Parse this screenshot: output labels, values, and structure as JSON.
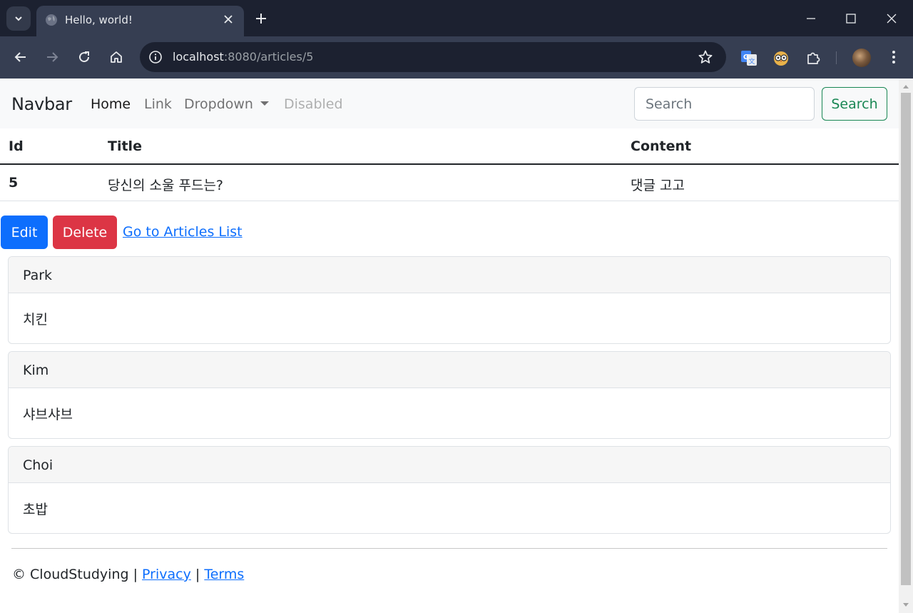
{
  "browser": {
    "tab_title": "Hello, world!",
    "url_host": "localhost",
    "url_path": ":8080/articles/5"
  },
  "icons": {
    "tab_list": "chevron-down-icon",
    "favicon": "globe-icon",
    "tab_close": "close-icon",
    "new_tab": "plus-icon",
    "minimize": "minimize-icon",
    "maximize": "maximize-icon",
    "window_close": "close-icon",
    "back": "arrow-left-icon",
    "forward": "arrow-right-icon",
    "reload": "reload-icon",
    "home": "home-icon",
    "site_info": "info-icon",
    "bookmark": "star-icon",
    "translate": "translate-icon",
    "extension_owl": "owl-icon",
    "extensions": "puzzle-icon",
    "menu": "three-dots-icon"
  },
  "navbar": {
    "brand": "Navbar",
    "links": [
      "Home",
      "Link",
      "Dropdown",
      "Disabled"
    ],
    "search_placeholder": "Search",
    "search_button": "Search"
  },
  "table": {
    "headers": [
      "Id",
      "Title",
      "Content"
    ],
    "row": {
      "id": "5",
      "title": "당신의 소울 푸드는?",
      "content": "댓글 고고"
    }
  },
  "actions": {
    "edit": "Edit",
    "delete": "Delete",
    "back_link": "Go to Articles List"
  },
  "comments": [
    {
      "nickname": "Park",
      "body": "치킨"
    },
    {
      "nickname": "Kim",
      "body": "샤브샤브"
    },
    {
      "nickname": "Choi",
      "body": "초밥"
    }
  ],
  "footer": {
    "copyright": "© CloudStudying |",
    "privacy": "Privacy",
    "separator": "|",
    "terms": "Terms"
  },
  "colors": {
    "primary": "#0d6efd",
    "danger": "#dc3545",
    "success": "#198754",
    "chrome_dark": "#1c2130",
    "chrome_toolbar": "#363e52"
  }
}
